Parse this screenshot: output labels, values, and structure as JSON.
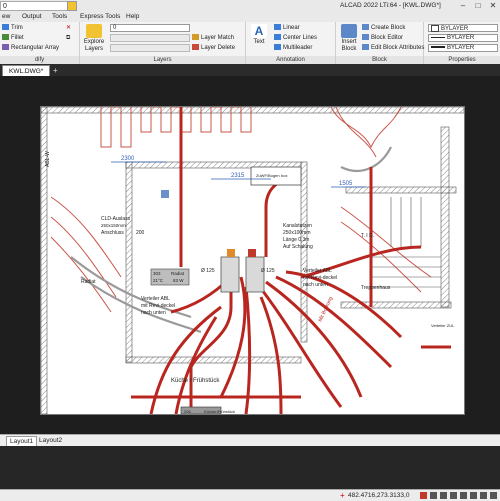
{
  "title_bar": {
    "quick_access_value": "0",
    "app_title": "ALCAD 2022 LTi:64  - [KWL.DWG*]",
    "minimize": "–",
    "maximize": "□",
    "close": "✕"
  },
  "menu": [
    "ew",
    "Output",
    "Tools",
    "Express Tools",
    "Help"
  ],
  "ribbon": {
    "modify": {
      "trim": "Trim",
      "fillet": "Fillet",
      "rect_array": "Rectangular Array",
      "label": "dify"
    },
    "layers": {
      "explore": "Explore Layers",
      "combo_value": "0",
      "layer_match": "Layer Match",
      "layer_delete": "Layer Delete",
      "label": "Layers"
    },
    "annotation": {
      "text": "Text",
      "linear": "Linear",
      "center_lines": "Center Lines",
      "multileader": "Multileader",
      "label": "Annotation"
    },
    "block": {
      "insert": "Insert Block",
      "create": "Create Block",
      "edit": "Block Editor",
      "edit_attr": "Edit Block Attributes",
      "label": "Block"
    },
    "properties": {
      "color_value": "BYLAYER",
      "linetype_value": "BYLAYER",
      "lineweight_value": "BYLAYER",
      "label": "Properties"
    }
  },
  "document_tab": "KWL.DWG*",
  "layout_tabs": [
    "Layout1",
    "Layout2"
  ],
  "drawing": {
    "labels": {
      "d2300": "2300",
      "d2315": "2315",
      "d1505": "1505",
      "cld_title": "CLD-Auslass",
      "cld_size": "250x150mm",
      "anschluss": "Anschluss",
      "d200": "200",
      "box_label": "ZuWF/Bogen",
      "box_label2": "box",
      "radiator_left": "Radiat",
      "unit_303": "303",
      "unit_21c": "21°C",
      "unit_radiat": "Radiat",
      "unit_83w": "83 W",
      "kanal_title": "Kanalstutzen",
      "kanal_size": "250x100mm",
      "kanal_len": "Länge   0,3m",
      "kanal_auf": "Auf Schalung",
      "d125a": "Ø 125",
      "d125b": "Ø 125",
      "vert_left": "Verteiler  ABL",
      "vert_left2": "mit  Revi-deckel",
      "vert_left3": "nach  unten",
      "vert_right": "Verteiler  ABL",
      "vert_right2": "mit  Revi-deckel",
      "vert_right3": "nach  unten",
      "kwl_note": "Mit Bohrung",
      "treppenhaus": "Treppenhaus",
      "kueche": "Küche / Frühstück",
      "abl_w": "ABL-W",
      "tft_block": "T.  I  D.",
      "bottom_box": "KüchenFrühstück",
      "bottom_num": "206",
      "verteiler_small": "Verteiler ZUL"
    }
  },
  "status": {
    "coords": "482.4716,273.3133,0"
  },
  "colors": {
    "duct_red": "#b8261f",
    "wall_hatch": "#777777",
    "dim_blue": "#2f5fb5",
    "highlight_orange": "#e08a2a"
  }
}
